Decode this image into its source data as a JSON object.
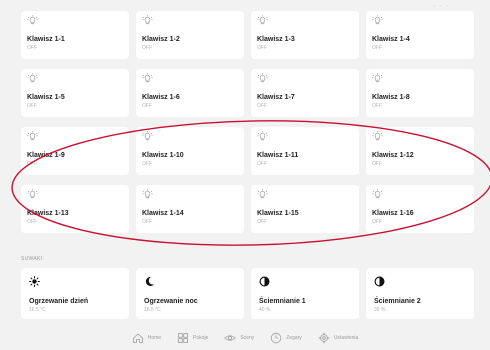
{
  "buttons": [
    {
      "label": "Klawisz 1-1",
      "status": "OFF"
    },
    {
      "label": "Klawisz 1-2",
      "status": "OFF"
    },
    {
      "label": "Klawisz 1-3",
      "status": "OFF"
    },
    {
      "label": "Klawisz 1-4",
      "status": "OFF"
    },
    {
      "label": "Klawisz 1-5",
      "status": "OFF"
    },
    {
      "label": "Klawisz 1-6",
      "status": "OFF"
    },
    {
      "label": "Klawisz 1-7",
      "status": "OFF"
    },
    {
      "label": "Klawisz 1-8",
      "status": "OFF"
    },
    {
      "label": "Klawisz 1-9",
      "status": "OFF"
    },
    {
      "label": "Klawisz 1-10",
      "status": "OFF"
    },
    {
      "label": "Klawisz 1-11",
      "status": "OFF"
    },
    {
      "label": "Klawisz 1-12",
      "status": "OFF"
    },
    {
      "label": "Klawisz 1-13",
      "status": "OFF"
    },
    {
      "label": "Klawisz 1-14",
      "status": "OFF"
    },
    {
      "label": "Klawisz 1-15",
      "status": "OFF"
    },
    {
      "label": "Klawisz 1-16",
      "status": "OFF"
    }
  ],
  "sliders_section": {
    "label": "SUWAKI",
    "items": [
      {
        "label": "Ogrzewanie dzień",
        "value": "16.5 °C",
        "icon": "sun-icon"
      },
      {
        "label": "Ogrzewanie noc",
        "value": "16.5 °C",
        "icon": "moon-icon"
      },
      {
        "label": "Ściemnianie 1",
        "value": "40 %",
        "icon": "half-circle-icon"
      },
      {
        "label": "Ściemnianie 2",
        "value": "30 %",
        "icon": "half-circle-icon"
      }
    ]
  },
  "nav": {
    "home": "Home",
    "rooms": "Pokoje",
    "scenes": "Sceny",
    "clocks": "Zegary",
    "settings": "Ustawienia"
  },
  "colors": {
    "background": "#f2f2f2",
    "card": "#ffffff",
    "annotation": "#c8102e"
  }
}
